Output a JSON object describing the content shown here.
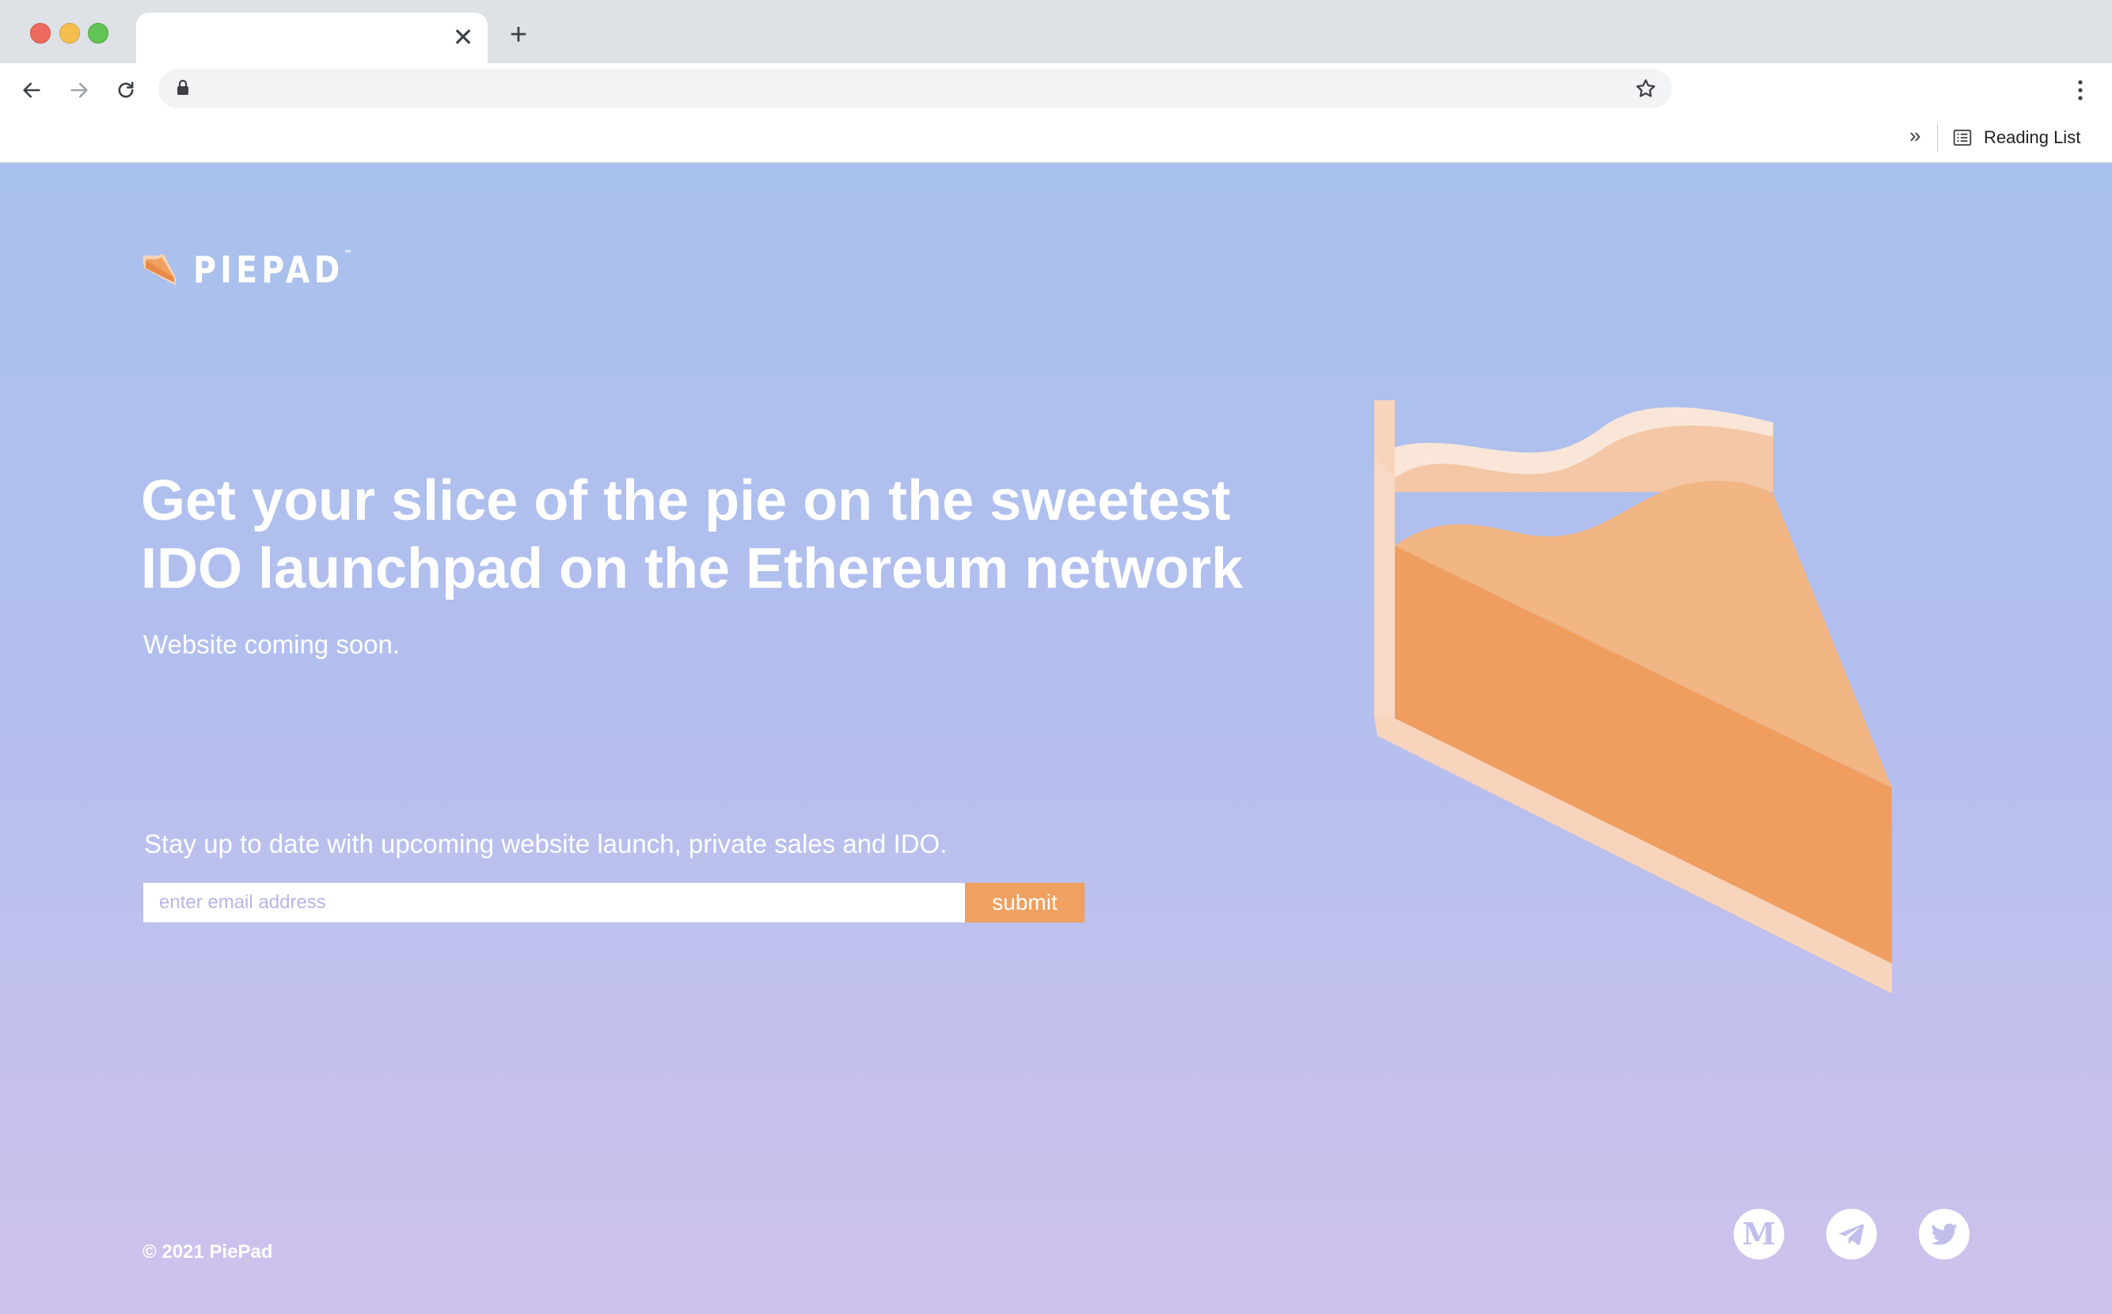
{
  "browser": {
    "tab_close_glyph": "✕",
    "new_tab_glyph": "+",
    "overflow_glyph": "»",
    "reading_list_label": "Reading List",
    "icons": [
      "back-arrow-icon",
      "forward-arrow-icon",
      "reload-icon",
      "lock-icon",
      "star-icon",
      "kebab-menu-icon",
      "reading-list-icon"
    ]
  },
  "page": {
    "logo_text": "PIEPAD",
    "logo_tm": "™",
    "headline": "Get your slice of the pie on the sweetest IDO launchpad on the Ethereum network",
    "subline": "Website coming soon.",
    "newsletter": {
      "prompt": "Stay up to date with upcoming website launch, private sales and IDO.",
      "placeholder": "enter email address",
      "value": "",
      "submit_label": "submit"
    },
    "footer": {
      "copyright": "© 2021 PiePad",
      "social": [
        "medium-icon",
        "telegram-icon",
        "twitter-icon"
      ]
    },
    "colors": {
      "accent": "#f0a060",
      "bg_top": "#a8c0ed",
      "bg_bottom": "#cec2ec"
    }
  }
}
